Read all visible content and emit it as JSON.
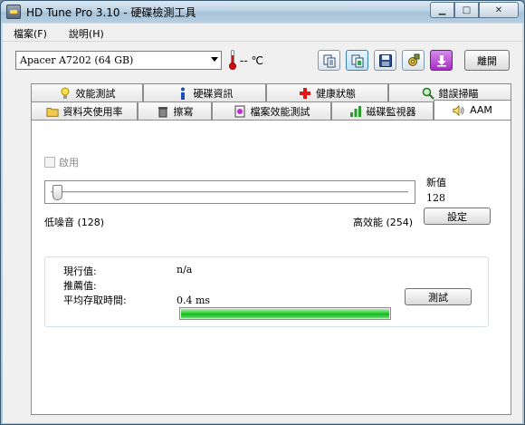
{
  "window": {
    "title": "HD Tune Pro 3.10 - 硬碟檢測工具"
  },
  "menu": [
    {
      "label": "檔案(F)"
    },
    {
      "label": "說明(H)"
    }
  ],
  "toolbar": {
    "drive": "Apacer A7202 (64 GB)",
    "temperature": "-- ℃",
    "buttons": [
      "copy-text-icon",
      "copy-screenshot-icon",
      "save-icon",
      "options-icon",
      "download-icon"
    ],
    "exit_label": "離開"
  },
  "tabs": {
    "row1": [
      {
        "label": "效能測試",
        "icon": "lightbulb-icon"
      },
      {
        "label": "硬碟資訊",
        "icon": "info-icon"
      },
      {
        "label": "健康狀態",
        "icon": "health-cross-icon"
      },
      {
        "label": "錯誤掃瞄",
        "icon": "magnifier-icon"
      }
    ],
    "row2": [
      {
        "label": "資料夾使用率",
        "icon": "folder-icon"
      },
      {
        "label": "擦寫",
        "icon": "trash-icon"
      },
      {
        "label": "檔案效能測試",
        "icon": "file-benchmark-icon"
      },
      {
        "label": "磁碟監視器",
        "icon": "disk-monitor-icon"
      },
      {
        "label": "AAM",
        "icon": "speaker-icon",
        "active": true
      }
    ]
  },
  "aam": {
    "enable_label": "啟用",
    "enabled": false,
    "new_value_label": "新值",
    "new_value": "128",
    "slider_value": 128,
    "slider_min": 128,
    "slider_max": 254,
    "low_noise_label": "低噪音 (128)",
    "high_perf_label": "高效能 (254)",
    "set_label": "設定",
    "current_label": "現行值:",
    "current_value": "n/a",
    "recommended_label": "推薦值:",
    "recommended_value": "",
    "access_time_label": "平均存取時間:",
    "access_time_value": "0.4 ms",
    "progress": 1.0,
    "test_label": "測試"
  },
  "colors": {
    "progress": "#22c22a",
    "temp_icon": "#d01010",
    "download_button": "#b832d6"
  }
}
